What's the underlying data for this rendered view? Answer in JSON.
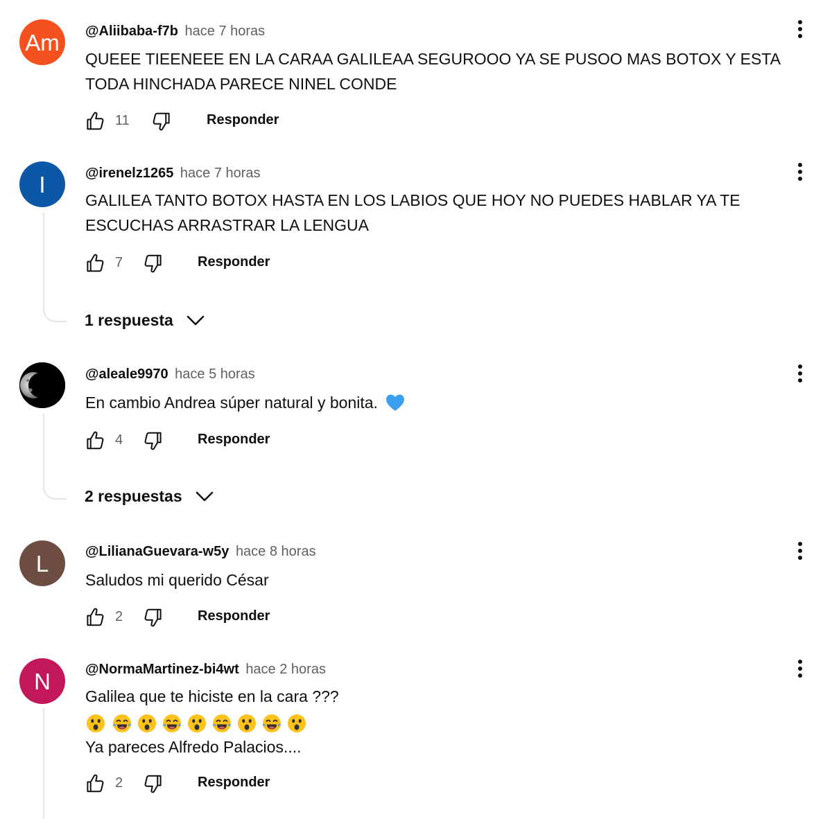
{
  "reply_label": "Responder",
  "comments": [
    {
      "handle": "@Aliibaba-f7b",
      "time": "hace 7 horas",
      "text": "QUEEE TIEENEEE EN LA CARAA GALILEAA SEGUROOO YA SE PUSOO MAS BOTOX Y ESTA TODA HINCHADA PARECE NINEL CONDE",
      "likes": "11",
      "avatar_initials": "Am",
      "avatar_color": "#f4511e"
    },
    {
      "handle": "@irenelz1265",
      "time": "hace 7 horas",
      "text": "GALILEA  TANTO BOTOX HASTA EN LOS LABIOS QUE HOY NO PUEDES HABLAR YA TE ESCUCHAS ARRASTRAR LA LENGUA",
      "likes": "7",
      "avatar_initials": "I",
      "avatar_color": "#0d58a6",
      "replies": "1 respuesta"
    },
    {
      "handle": "@aleale9970",
      "time": "hace 5 horas",
      "text": "En cambio Andrea súper natural y bonita.",
      "text_emoji": "blue-heart-icon",
      "likes": "4",
      "avatar_icon": "moon-avatar-icon",
      "replies": "2 respuestas"
    },
    {
      "handle": "@LilianaGuevara-w5y",
      "time": "hace 8 horas",
      "text": "Saludos mi querido César",
      "likes": "2",
      "avatar_initials": "L",
      "avatar_color": "#6d4c41"
    },
    {
      "handle": "@NormaMartinez-bi4wt",
      "time": "hace 2 horas",
      "text": "Galilea que te hiciste en la cara ???",
      "emoji_row": [
        "astonished",
        "joy",
        "astonished",
        "joy",
        "astonished",
        "joy",
        "astonished",
        "joy",
        "astonished"
      ],
      "text_line3": "Ya pareces Alfredo Palacios....",
      "likes": "2",
      "avatar_initials": "N",
      "avatar_color": "#c2185b"
    }
  ]
}
